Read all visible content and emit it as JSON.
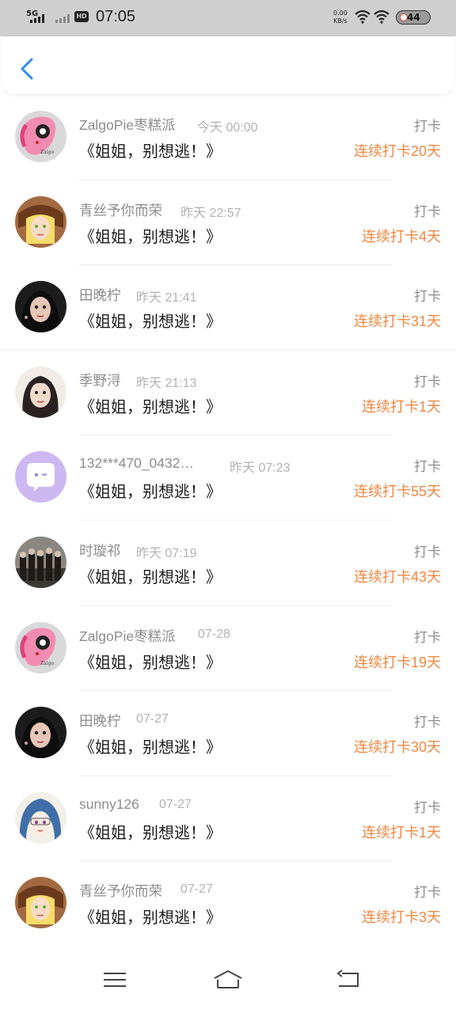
{
  "status_bar": {
    "network": "5G",
    "hd": "HD",
    "time": "07:05",
    "speed_value": "0.00",
    "speed_unit": "KB/s",
    "battery": "44"
  },
  "colors": {
    "streak": "#ef8743",
    "back_arrow": "#2c8ce6",
    "secondary_text": "#8d8d8d"
  },
  "records": [
    {
      "user": "ZalgoPie枣糕派",
      "time": "今天 00:00",
      "title": "《姐姐，别想逃！》",
      "tag": "打卡",
      "streak": "连续打卡20天",
      "avatar": "pink-pony"
    },
    {
      "user": "青丝予你而荣",
      "time": "昨天 22:57",
      "title": "《姐姐，别想逃！》",
      "tag": "打卡",
      "streak": "连续打卡4天",
      "avatar": "anime-blonde"
    },
    {
      "user": "田晚柠",
      "time": "昨天 21:41",
      "title": "《姐姐，别想逃！》",
      "tag": "打卡",
      "streak": "连续打卡31天",
      "avatar": "girl-dark"
    },
    {
      "user": "季野浔",
      "time": "昨天 21:13",
      "title": "《姐姐，别想逃！》",
      "tag": "打卡",
      "streak": "连续打卡1天",
      "avatar": "girl-light"
    },
    {
      "user": "132***470_0432…",
      "time": "昨天 07:23",
      "title": "《姐姐，别想逃！》",
      "tag": "打卡",
      "streak": "连续打卡55天",
      "avatar": "default-chat"
    },
    {
      "user": "时璇祁",
      "time": "昨天 07:19",
      "title": "《姐姐，别想逃！》",
      "tag": "打卡",
      "streak": "连续打卡43天",
      "avatar": "group-photo"
    },
    {
      "user": "ZalgoPie枣糕派",
      "time": "07-28",
      "title": "《姐姐，别想逃！》",
      "tag": "打卡",
      "streak": "连续打卡19天",
      "avatar": "pink-pony"
    },
    {
      "user": "田晚柠",
      "time": "07-27",
      "title": "《姐姐，别想逃！》",
      "tag": "打卡",
      "streak": "连续打卡30天",
      "avatar": "girl-dark"
    },
    {
      "user": "sunny126",
      "time": "07-27",
      "title": "《姐姐，别想逃！》",
      "tag": "打卡",
      "streak": "连续打卡1天",
      "avatar": "anime-blue"
    },
    {
      "user": "青丝予你而荣",
      "time": "07-27",
      "title": "《姐姐，别想逃！》",
      "tag": "打卡",
      "streak": "连续打卡3天",
      "avatar": "anime-blonde"
    }
  ],
  "nav_bar": {
    "icons": [
      "menu-icon",
      "home-icon",
      "back-icon"
    ]
  }
}
